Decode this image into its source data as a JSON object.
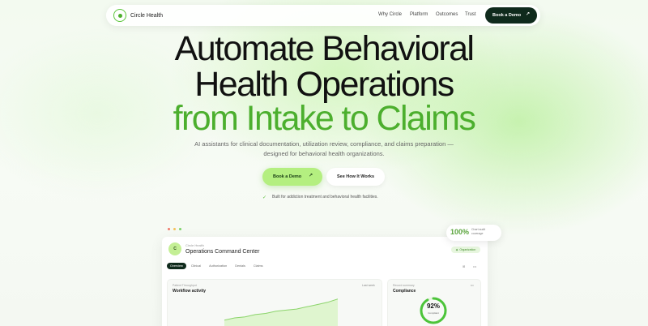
{
  "nav": {
    "brand": "Circle Health",
    "links": [
      "Why Circle",
      "Platform",
      "Outcomes",
      "Trust"
    ],
    "cta": "Book a Demo"
  },
  "hero": {
    "line1": "Automate Behavioral",
    "line2": "Health Operations",
    "line3": "from Intake to Claims",
    "subtitle": "AI assistants for clinical documentation, utilization review, compliance, and claims preparation — designed for behavioral health organizations.",
    "primary_cta": "Book a Demo",
    "secondary_cta": "See How It Works",
    "note": "Built for addiction treatment and behavioral health facilities."
  },
  "dashboard": {
    "avatar_initial": "C",
    "org": "Circle Health",
    "title": "Operations Command Center",
    "badge": "Organization",
    "tabs": [
      "Overview",
      "Clinical",
      "Authorization",
      "Denials",
      "Claims"
    ],
    "active_tab": "Overview",
    "workflow_card": {
      "eyebrow": "Patient Throughput",
      "title": "Workflow activity",
      "range": "Last week"
    },
    "compliance_card": {
      "eyebrow": "Record summary",
      "title": "Compliance",
      "percent": "92%",
      "percent_value": 92,
      "label": "Compliant"
    },
    "trend": [
      6,
      8,
      9,
      11,
      12,
      14,
      15,
      16,
      18,
      20,
      22,
      25
    ]
  },
  "float_badge": {
    "value": "100%",
    "label": "Chart audit coverage"
  },
  "colors": {
    "brand_green": "#4caf2e",
    "dark": "#0f2a1c",
    "cta_green": "#b4ef80"
  }
}
